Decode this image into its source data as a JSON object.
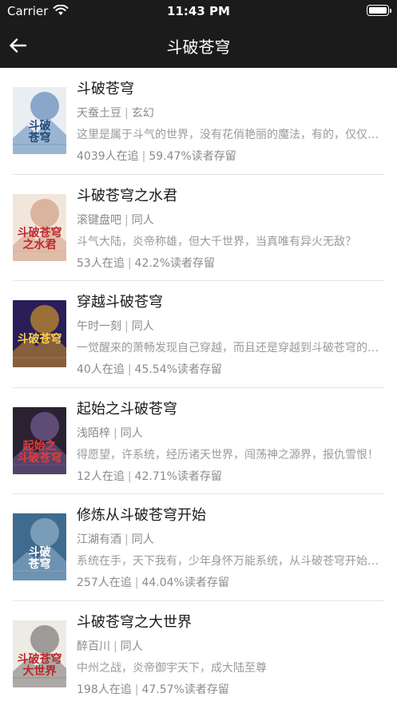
{
  "status": {
    "carrier": "Carrier",
    "time": "11:43 PM"
  },
  "nav": {
    "title": "斗破苍穹"
  },
  "books": [
    {
      "title": "斗破苍穹",
      "author": "天蚕土豆",
      "category": "玄幻",
      "description": "这里是属于斗气的世界，没有花俏艳丽的魔法，有的，仅仅是繁衍到巅峰的斗气！",
      "followers": "4039人在追",
      "retention": "59.47%读者存留",
      "cover": {
        "title": "斗破\n苍穹",
        "bg": "#e9eef3",
        "accent": "#3a6ea8",
        "ink": "#234a78"
      }
    },
    {
      "title": "斗破苍穹之水君",
      "author": "滚键盘吧",
      "category": "同人",
      "description": "斗气大陆，炎帝称雄，但大千世界，当真唯有异火无敌？",
      "followers": "53人在追",
      "retention": "42.2%读者存留",
      "cover": {
        "title": "斗破苍穹\n之水君",
        "bg": "#f1e6dc",
        "accent": "#c98b6a",
        "ink": "#c0282f"
      }
    },
    {
      "title": "穿越斗破苍穹",
      "author": "午时一刻",
      "category": "同人",
      "description": "一觉醒来的萧畅发现自己穿越，而且还是穿越到斗破苍穹的世界里。",
      "followers": "40人在追",
      "retention": "45.54%读者存留",
      "cover": {
        "title": "斗破苍穹",
        "bg": "#2a1d5a",
        "accent": "#f5b21d",
        "ink": "#ffd24a"
      }
    },
    {
      "title": "起始之斗破苍穹",
      "author": "浅陌梓",
      "category": "同人",
      "description": "得愿望，许系统，经历诸天世界，闯荡神之源界，报仇雪恨！",
      "followers": "12人在追",
      "retention": "42.71%读者存留",
      "cover": {
        "title": "起始之\n斗破苍穹",
        "bg": "#2a2230",
        "accent": "#8a6fb0",
        "ink": "#e23b3b"
      }
    },
    {
      "title": "修炼从斗破苍穹开始",
      "author": "江湖有酒",
      "category": "同人",
      "description": "系统在手，天下我有，少年身怀万能系统，从斗破苍穹开始修炼。",
      "followers": "257人在追",
      "retention": "44.04%读者存留",
      "cover": {
        "title": "斗破\n苍穹",
        "bg": "#3f6b8e",
        "accent": "#a9c6dd",
        "ink": "#ffffff"
      }
    },
    {
      "title": "斗破苍穹之大世界",
      "author": "醉百川",
      "category": "同人",
      "description": "中州之战，炎帝御宇天下，成大陆至尊",
      "followers": "198人在追",
      "retention": "47.57%读者存留",
      "cover": {
        "title": "斗破苍穹\n大世界",
        "bg": "#eeeae4",
        "accent": "#5a5a5a",
        "ink": "#b8262a"
      }
    }
  ]
}
